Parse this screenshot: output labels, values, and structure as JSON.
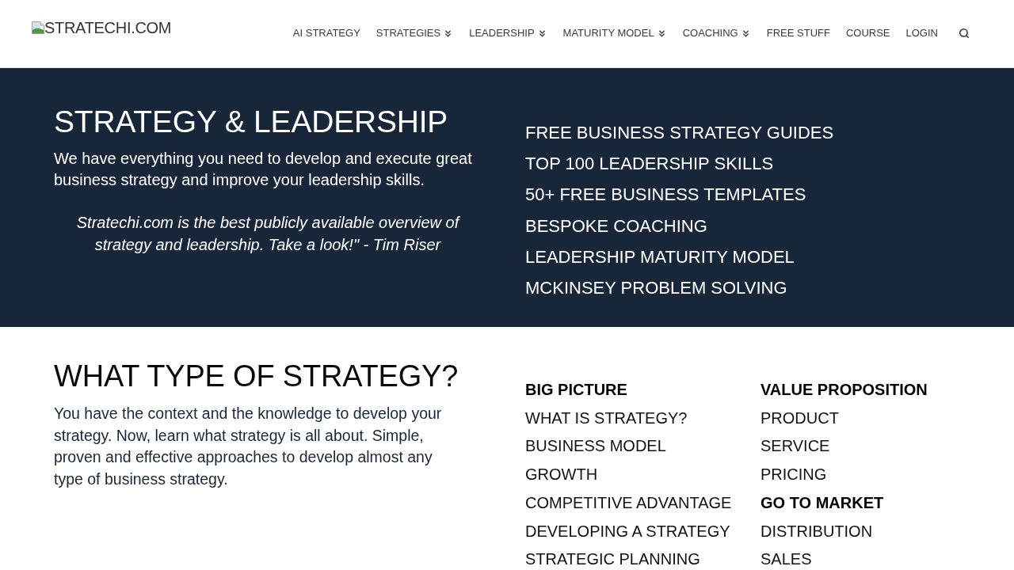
{
  "header": {
    "logo_text": "STRATECHI.COM",
    "nav": [
      {
        "label": "AI STRATEGY",
        "dropdown": false
      },
      {
        "label": "STRATEGIES",
        "dropdown": true
      },
      {
        "label": "LEADERSHIP",
        "dropdown": true
      },
      {
        "label": "MATURITY MODEL",
        "dropdown": true
      },
      {
        "label": "COACHING",
        "dropdown": true
      },
      {
        "label": "FREE STUFF",
        "dropdown": false
      },
      {
        "label": "COURSE",
        "dropdown": false
      },
      {
        "label": "LOGIN",
        "dropdown": false
      }
    ]
  },
  "hero": {
    "title": "STRATEGY & LEADERSHIP",
    "intro": "We have everything you need to develop and execute great business strategy and improve your leadership skills.",
    "quote": "Stratechi.com is the best publicly available overview of strategy and leadership. Take a look!\" - Tim Riser",
    "links": [
      "FREE BUSINESS STRATEGY GUIDES",
      "TOP 100 LEADERSHIP SKILLS",
      "50+ FREE BUSINESS TEMPLATES",
      "BESPOKE COACHING",
      "LEADERSHIP MATURITY MODEL",
      "MCKINSEY PROBLEM SOLVING"
    ]
  },
  "strategy_section": {
    "title": "WHAT TYPE OF STRATEGY?",
    "description": "You have the context and the knowledge to develop your strategy. Now, learn what strategy is all about. Simple, proven and effective approaches to develop almost any type of business strategy.",
    "columns": [
      {
        "items": [
          {
            "kind": "heading",
            "label": "BIG PICTURE"
          },
          {
            "kind": "link",
            "label": "WHAT IS STRATEGY?"
          },
          {
            "kind": "link",
            "label": "BUSINESS MODEL"
          },
          {
            "kind": "link",
            "label": "GROWTH"
          },
          {
            "kind": "link",
            "label": "COMPETITIVE ADVANTAGE"
          },
          {
            "kind": "link",
            "label": "DEVELOPING A STRATEGY"
          },
          {
            "kind": "link",
            "label": "STRATEGIC PLANNING"
          }
        ]
      },
      {
        "items": [
          {
            "kind": "heading",
            "label": "VALUE PROPOSITION"
          },
          {
            "kind": "link",
            "label": "PRODUCT"
          },
          {
            "kind": "link",
            "label": "SERVICE"
          },
          {
            "kind": "link",
            "label": "PRICING"
          },
          {
            "kind": "heading",
            "label": "GO TO MARKET"
          },
          {
            "kind": "link",
            "label": "DISTRIBUTION"
          },
          {
            "kind": "link",
            "label": "SALES"
          }
        ]
      }
    ]
  }
}
